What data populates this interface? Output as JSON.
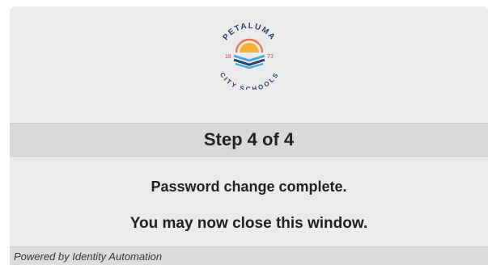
{
  "logo": {
    "top_text": "PETALUMA",
    "bottom_text": "CITY SCHOOLS",
    "year_left": "18",
    "year_right": "73",
    "colors": {
      "navy": "#2f3c6b",
      "rose": "#d8737f",
      "sky": "#4aa8d8",
      "sun": "#f2b53a",
      "coral": "#e8735a"
    }
  },
  "step": {
    "title": "Step 4 of 4"
  },
  "messages": {
    "complete": "Password change complete.",
    "close": "You may now close this window."
  },
  "footer": {
    "powered_by": "Powered by Identity Automation"
  }
}
